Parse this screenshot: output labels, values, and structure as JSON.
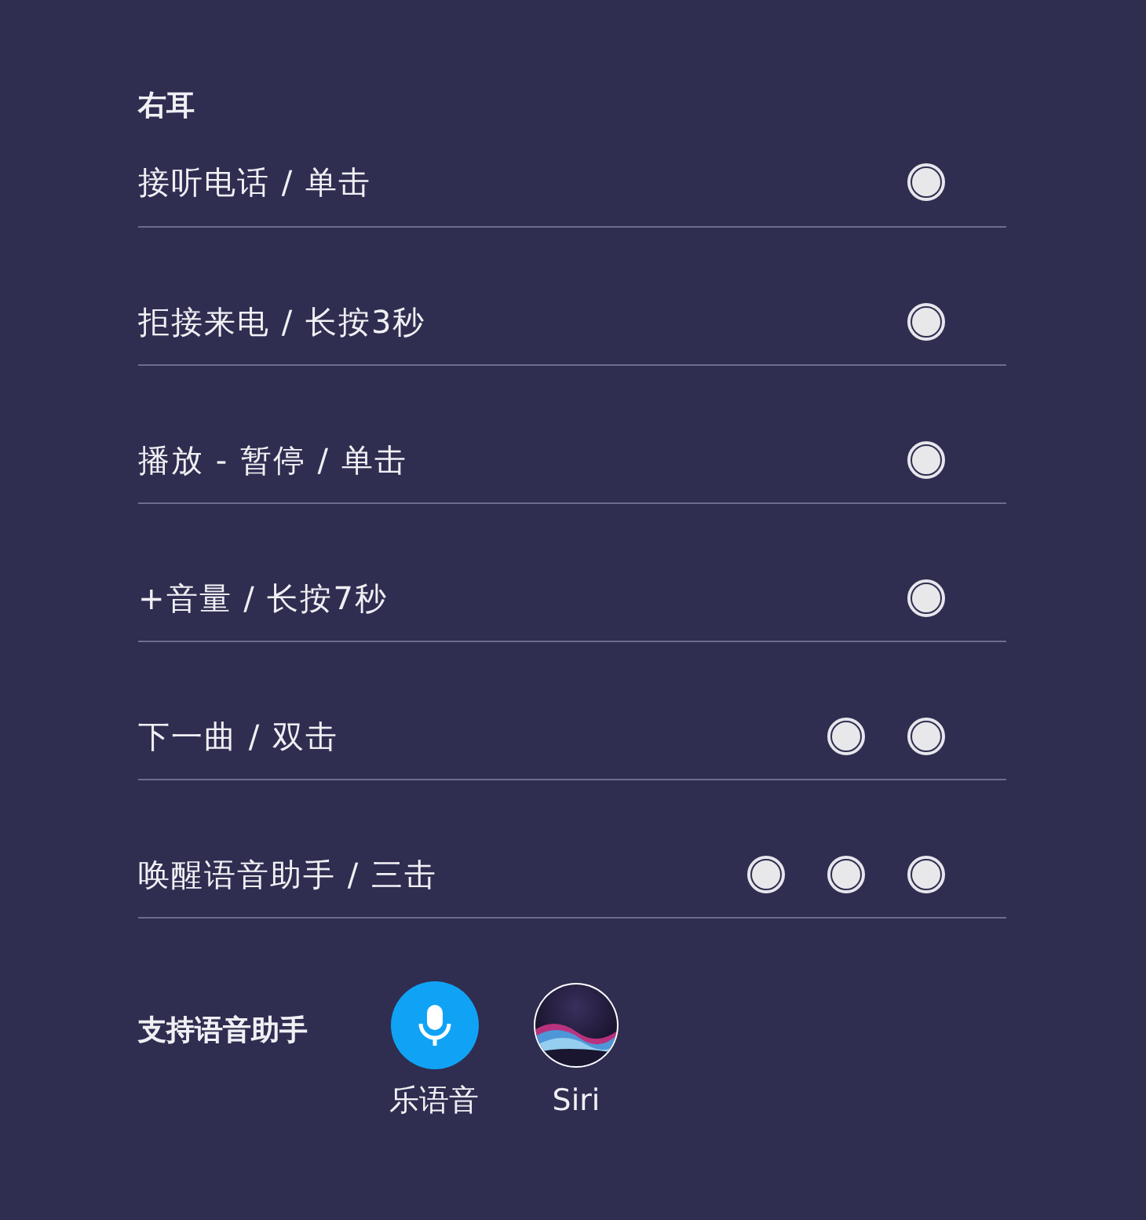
{
  "section_title": "右耳",
  "gestures": [
    {
      "label": "接听电话 / 单击",
      "kind": "single"
    },
    {
      "label": "拒接来电 / 长按3秒",
      "kind": "single"
    },
    {
      "label": "播放 - 暂停 / 单击",
      "kind": "single"
    },
    {
      "label": "+音量 / 长按7秒",
      "kind": "single"
    },
    {
      "label": "下一曲 / 双击",
      "kind": "double"
    },
    {
      "label": "唤醒语音助手 / 三击",
      "kind": "triple"
    }
  ],
  "assistants": {
    "title": "支持语音助手",
    "items": [
      {
        "label": "乐语音",
        "kind": "mic"
      },
      {
        "label": "Siri",
        "kind": "siri"
      }
    ]
  }
}
